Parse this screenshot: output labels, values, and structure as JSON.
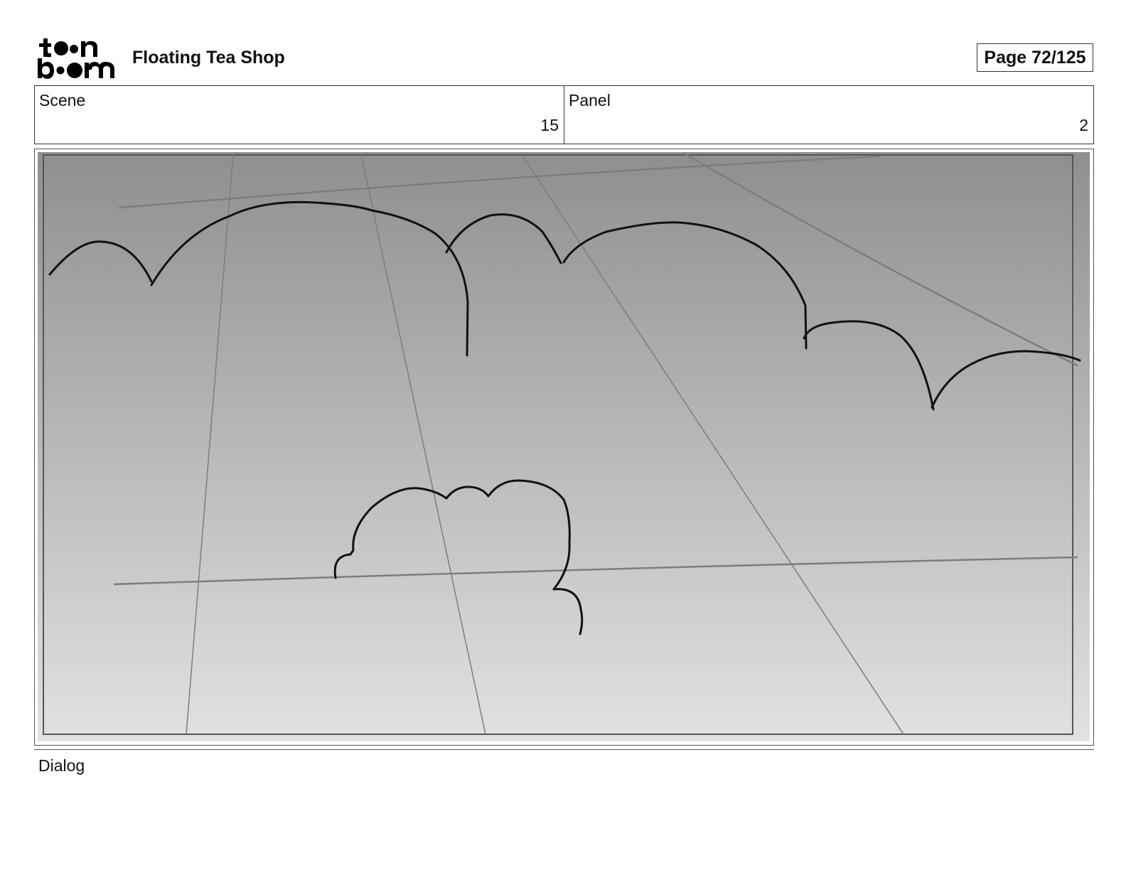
{
  "header": {
    "logo_name": "toonboom-logo",
    "project_title": "Floating Tea Shop",
    "page_label": "Page  72/125"
  },
  "info": {
    "scene_label": "Scene",
    "scene_value": "15",
    "panel_label": "Panel",
    "panel_value": "2"
  },
  "panel": {
    "description_visible": false,
    "gradient_top": "#8f8f8f",
    "gradient_bottom": "#e2e2e2"
  },
  "dialog": {
    "label": "Dialog",
    "text": ""
  }
}
